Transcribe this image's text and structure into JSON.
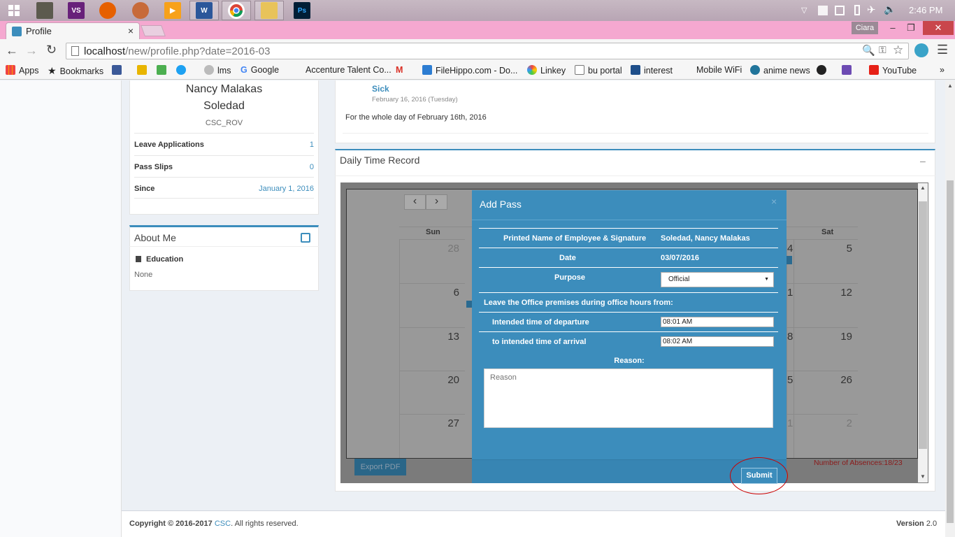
{
  "taskbar": {
    "clock": "2:46 PM",
    "icons": [
      "windows-start-icon",
      "visual-studio-icon",
      "firefox-icon",
      "paint-icon",
      "media-icon",
      "word-icon",
      "chrome-icon",
      "file-explorer-icon",
      "photoshop-icon"
    ]
  },
  "browser": {
    "tab_title": "Profile",
    "tab_close": "×",
    "user_name": "Ciara",
    "minimize": "–",
    "restore": "❐",
    "close": "✕",
    "url_host": "localhost",
    "url_path": "/new/profile.php?date=2016-03",
    "bookmarks": {
      "apps": "Apps",
      "bookmarks": "Bookmarks",
      "lms": "lms",
      "google": "Google",
      "accenture": "Accenture Talent Co...",
      "filehippo": "FileHippo.com - Do...",
      "linkey": "Linkey",
      "bu_portal": "bu portal",
      "interest": "interest",
      "mobile_wifi": "Mobile WiFi",
      "anime_news": "anime news",
      "youtube": "YouTube",
      "more": "»"
    }
  },
  "profile": {
    "name_line1": "Nancy Malakas",
    "name_line2": "Soledad",
    "office": "CSC_ROV",
    "stats": [
      {
        "label": "Leave Applications",
        "value": "1"
      },
      {
        "label": "Pass Slips",
        "value": "0"
      },
      {
        "label": "Since",
        "value": "January 1, 2016"
      }
    ]
  },
  "about": {
    "title": "About Me",
    "education_label": "Education",
    "education_value": "None"
  },
  "leave_entry": {
    "type": "Sick",
    "date": "February 16, 2016 (Tuesday)",
    "description": "For the whole day of February 16th, 2016"
  },
  "dtr": {
    "title": "Daily Time Record",
    "collapse": "–",
    "prev": "‹",
    "next": "›",
    "day_headers": {
      "sun": "Sun",
      "sat": "Sat"
    },
    "sun_dates": [
      "28",
      "6",
      "13",
      "20",
      "27"
    ],
    "sat_dates": [
      "5",
      "12",
      "19",
      "26",
      "2"
    ],
    "fri_dates": [
      "4",
      "1",
      "8",
      "5",
      "1"
    ],
    "export_label": "Export PDF",
    "absences": "Number of Absences:18/23"
  },
  "modal": {
    "title": "Add Pass",
    "close": "×",
    "name_label": "Printed Name of Employee & Signature",
    "name_value": "Soledad, Nancy Malakas",
    "date_label": "Date",
    "date_value": "03/07/2016",
    "purpose_label": "Purpose",
    "purpose_value": "Official",
    "leave_label": "Leave the Office premises during office hours from:",
    "departure_label": "Intended time of departure",
    "departure_value": "08:01 AM",
    "arrival_label": "to intended time of arrival",
    "arrival_value": "08:02 AM",
    "reason_label": "Reason:",
    "reason_placeholder": "Reason",
    "submit_label": "Submit"
  },
  "footer": {
    "copyright_prefix": "Copyright © 2016-2017",
    "copyright_org": "CSC",
    "copyright_suffix": ". All rights reserved.",
    "version_label": "Version",
    "version_value": "2.0"
  },
  "colors": {
    "accent": "#3c8dbc",
    "modal_bg": "#3c8dbc",
    "taskbar": "#c7b9c3",
    "tabbar": "#f5a8d0",
    "absences_text": "#8b1a1a",
    "annotation_circle": "#cc0000"
  }
}
